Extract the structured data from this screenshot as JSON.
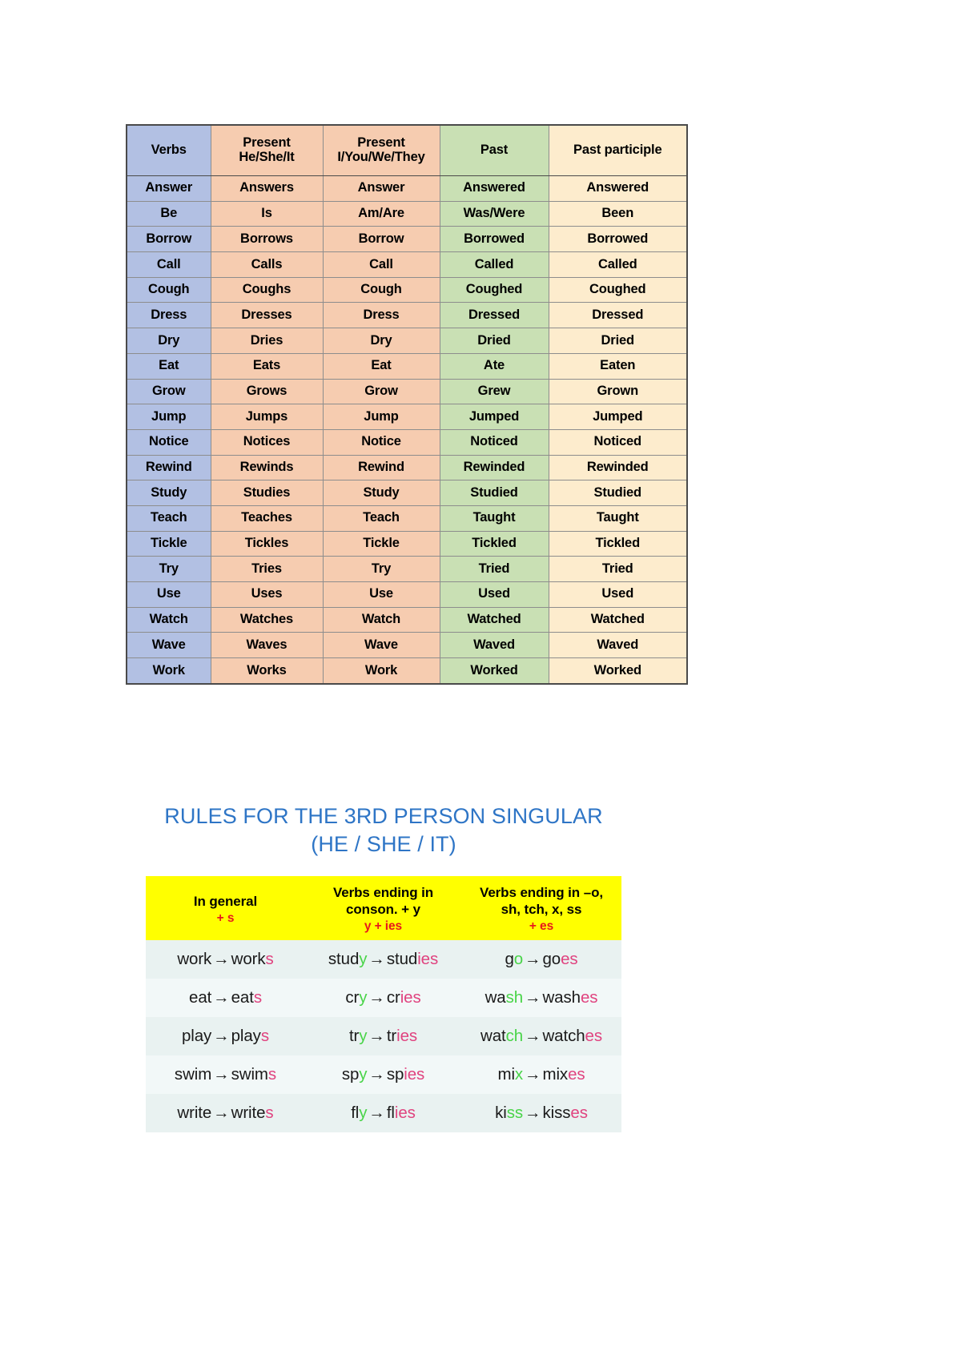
{
  "verb_table": {
    "headers": [
      {
        "lines": [
          "Verbs"
        ],
        "color": "#b2c0e3"
      },
      {
        "lines": [
          "Present",
          "He/She/It"
        ],
        "color": "#f6ccb0"
      },
      {
        "lines": [
          "Present",
          "I/You/We/They"
        ],
        "color": "#f6ccb0"
      },
      {
        "lines": [
          "Past"
        ],
        "color": "#c9e0b4"
      },
      {
        "lines": [
          "Past participle"
        ],
        "color": "#fdeccd"
      }
    ],
    "rows": [
      [
        "Answer",
        "Answers",
        "Answer",
        "Answered",
        "Answered"
      ],
      [
        "Be",
        "Is",
        "Am/Are",
        "Was/Were",
        "Been"
      ],
      [
        "Borrow",
        "Borrows",
        "Borrow",
        "Borrowed",
        "Borrowed"
      ],
      [
        "Call",
        "Calls",
        "Call",
        "Called",
        "Called"
      ],
      [
        "Cough",
        "Coughs",
        "Cough",
        "Coughed",
        "Coughed"
      ],
      [
        "Dress",
        "Dresses",
        "Dress",
        "Dressed",
        "Dressed"
      ],
      [
        "Dry",
        "Dries",
        "Dry",
        "Dried",
        "Dried"
      ],
      [
        "Eat",
        "Eats",
        "Eat",
        "Ate",
        "Eaten"
      ],
      [
        "Grow",
        "Grows",
        "Grow",
        "Grew",
        "Grown"
      ],
      [
        "Jump",
        "Jumps",
        "Jump",
        "Jumped",
        "Jumped"
      ],
      [
        "Notice",
        "Notices",
        "Notice",
        "Noticed",
        "Noticed"
      ],
      [
        "Rewind",
        "Rewinds",
        "Rewind",
        "Rewinded",
        "Rewinded"
      ],
      [
        "Study",
        "Studies",
        "Study",
        "Studied",
        "Studied"
      ],
      [
        "Teach",
        "Teaches",
        "Teach",
        "Taught",
        "Taught"
      ],
      [
        "Tickle",
        "Tickles",
        "Tickle",
        "Tickled",
        "Tickled"
      ],
      [
        "Try",
        "Tries",
        "Try",
        "Tried",
        "Tried"
      ],
      [
        "Use",
        "Uses",
        "Use",
        "Used",
        "Used"
      ],
      [
        "Watch",
        "Watches",
        "Watch",
        "Watched",
        "Watched"
      ],
      [
        "Wave",
        "Waves",
        "Wave",
        "Waved",
        "Waved"
      ],
      [
        "Work",
        "Works",
        "Work",
        "Worked",
        "Worked"
      ]
    ]
  },
  "rules": {
    "title": "RULES FOR THE 3RD PERSON SINGULAR (HE / SHE / IT)",
    "title_color": "#2e75c6",
    "header_bg": "#ffff00",
    "accent_color": "#e8191b",
    "green_color": "#49d449",
    "pink_color": "#e0437f",
    "headers": [
      {
        "lines": [
          "In general"
        ],
        "accent": "+ s"
      },
      {
        "lines": [
          "Verbs ending in",
          "conson. + y"
        ],
        "accent": "y + ies"
      },
      {
        "lines": [
          "Verbs ending in –o,",
          "sh, tch, x, ss"
        ],
        "accent": "+ es"
      }
    ],
    "rows": [
      [
        {
          "base_plain": "work",
          "base_green": "",
          "result_plain": "work",
          "result_pink": "s"
        },
        {
          "base_plain": "stud",
          "base_green": "y",
          "result_plain": "stud",
          "result_pink": "ies"
        },
        {
          "base_plain": "g",
          "base_green": "o",
          "result_plain": "go",
          "result_pink": "es"
        }
      ],
      [
        {
          "base_plain": "eat",
          "base_green": "",
          "result_plain": "eat",
          "result_pink": "s"
        },
        {
          "base_plain": "cr",
          "base_green": "y",
          "result_plain": "cr",
          "result_pink": "ies"
        },
        {
          "base_plain": "wa",
          "base_green": "sh",
          "result_plain": "wash",
          "result_pink": "es"
        }
      ],
      [
        {
          "base_plain": "play",
          "base_green": "",
          "result_plain": "play",
          "result_pink": "s"
        },
        {
          "base_plain": "tr",
          "base_green": "y",
          "result_plain": "tr",
          "result_pink": "ies"
        },
        {
          "base_plain": "wat",
          "base_green": "ch",
          "result_plain": "watch",
          "result_pink": "es"
        }
      ],
      [
        {
          "base_plain": "swim",
          "base_green": "",
          "result_plain": "swim",
          "result_pink": "s"
        },
        {
          "base_plain": "sp",
          "base_green": "y",
          "result_plain": "sp",
          "result_pink": "ies"
        },
        {
          "base_plain": "mi",
          "base_green": "x",
          "result_plain": "mix",
          "result_pink": "es"
        }
      ],
      [
        {
          "base_plain": "write",
          "base_green": "",
          "result_plain": "write",
          "result_pink": "s"
        },
        {
          "base_plain": "fl",
          "base_green": "y",
          "result_plain": "fl",
          "result_pink": "ies"
        },
        {
          "base_plain": "ki",
          "base_green": "ss",
          "result_plain": "kiss",
          "result_pink": "es"
        }
      ]
    ],
    "arrow": "→"
  }
}
